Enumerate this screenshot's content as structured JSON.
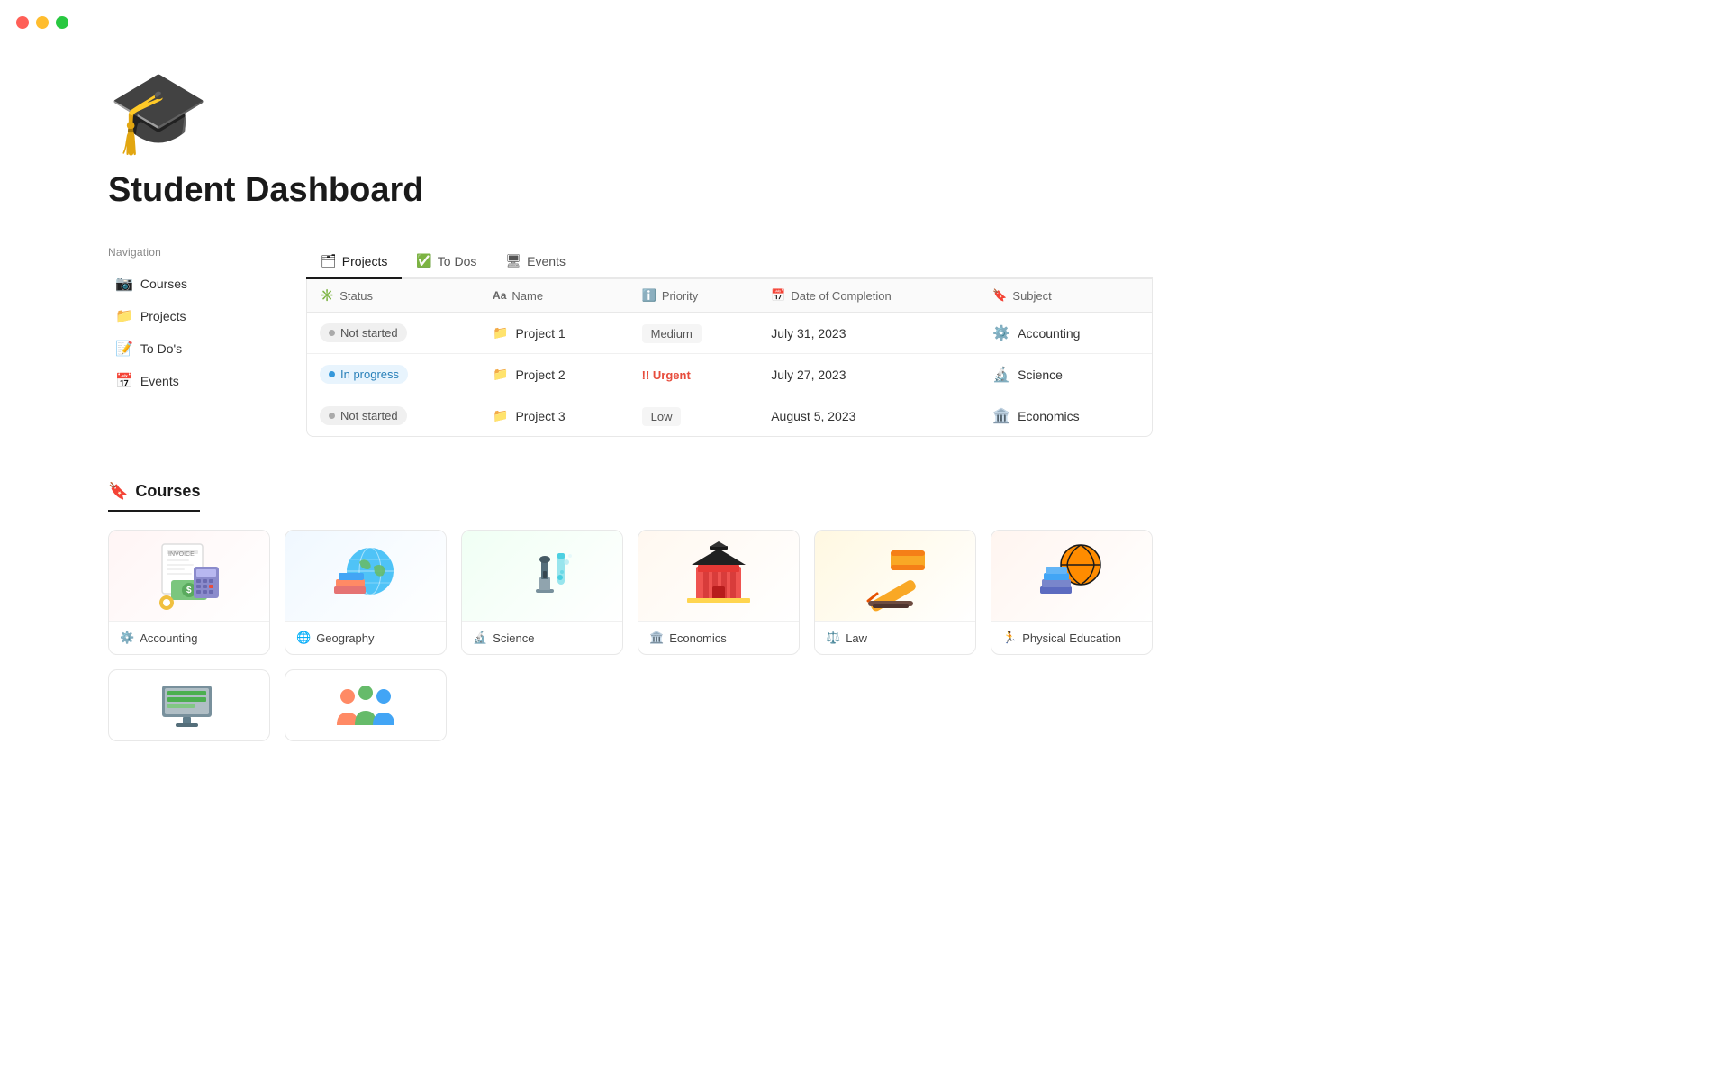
{
  "window": {
    "traffic_lights": {
      "red": "close",
      "yellow": "minimize",
      "green": "maximize"
    }
  },
  "page": {
    "emoji": "🎓",
    "title": "Student Dashboard"
  },
  "sidebar": {
    "nav_label": "Navigation",
    "items": [
      {
        "id": "courses",
        "icon": "📷",
        "label": "Courses"
      },
      {
        "id": "projects",
        "icon": "📁",
        "label": "Projects"
      },
      {
        "id": "todos",
        "icon": "📝",
        "label": "To Do's"
      },
      {
        "id": "events",
        "icon": "📅",
        "label": "Events"
      }
    ]
  },
  "tabs": [
    {
      "id": "projects",
      "icon": "🗂",
      "label": "Projects",
      "active": true
    },
    {
      "id": "todos",
      "icon": "✅",
      "label": "To Dos",
      "active": false
    },
    {
      "id": "events",
      "icon": "🖥",
      "label": "Events",
      "active": false
    }
  ],
  "table": {
    "columns": [
      {
        "id": "status",
        "icon": "✳",
        "label": "Status"
      },
      {
        "id": "name",
        "icon": "Aa",
        "label": "Name"
      },
      {
        "id": "priority",
        "icon": "ℹ",
        "label": "Priority"
      },
      {
        "id": "date",
        "icon": "📅",
        "label": "Date of Completion"
      },
      {
        "id": "subject",
        "icon": "🔖",
        "label": "Subject"
      }
    ],
    "rows": [
      {
        "status": "Not started",
        "status_type": "not-started",
        "name": "Project 1",
        "priority": "Medium",
        "priority_type": "medium",
        "date": "July 31, 2023",
        "subject": "Accounting",
        "subject_icon": "⚙"
      },
      {
        "status": "In progress",
        "status_type": "in-progress",
        "name": "Project 2",
        "priority": "!! Urgent",
        "priority_type": "urgent",
        "date": "July 27, 2023",
        "subject": "Science",
        "subject_icon": "🔬"
      },
      {
        "status": "Not started",
        "status_type": "not-started",
        "name": "Project 3",
        "priority": "Low",
        "priority_type": "low",
        "date": "August 5, 2023",
        "subject": "Economics",
        "subject_icon": "🏛"
      }
    ]
  },
  "courses_section": {
    "title": "Courses",
    "title_icon": "🔖",
    "cards": [
      {
        "id": "accounting",
        "label": "Accounting",
        "icon": "⚙",
        "emoji": "🧾"
      },
      {
        "id": "geography",
        "label": "Geography",
        "icon": "🌐",
        "emoji": "🌍"
      },
      {
        "id": "science",
        "label": "Science",
        "icon": "🔬",
        "emoji": "🔬"
      },
      {
        "id": "economics",
        "label": "Economics",
        "icon": "🏛",
        "emoji": "🏛"
      },
      {
        "id": "law",
        "label": "Law",
        "icon": "⚖",
        "emoji": "⚖"
      },
      {
        "id": "pe",
        "label": "Physical Education",
        "icon": "🏃",
        "emoji": "🏀"
      }
    ],
    "bottom_cards": [
      {
        "id": "it",
        "emoji": "💻"
      },
      {
        "id": "group",
        "emoji": "👥"
      }
    ]
  }
}
